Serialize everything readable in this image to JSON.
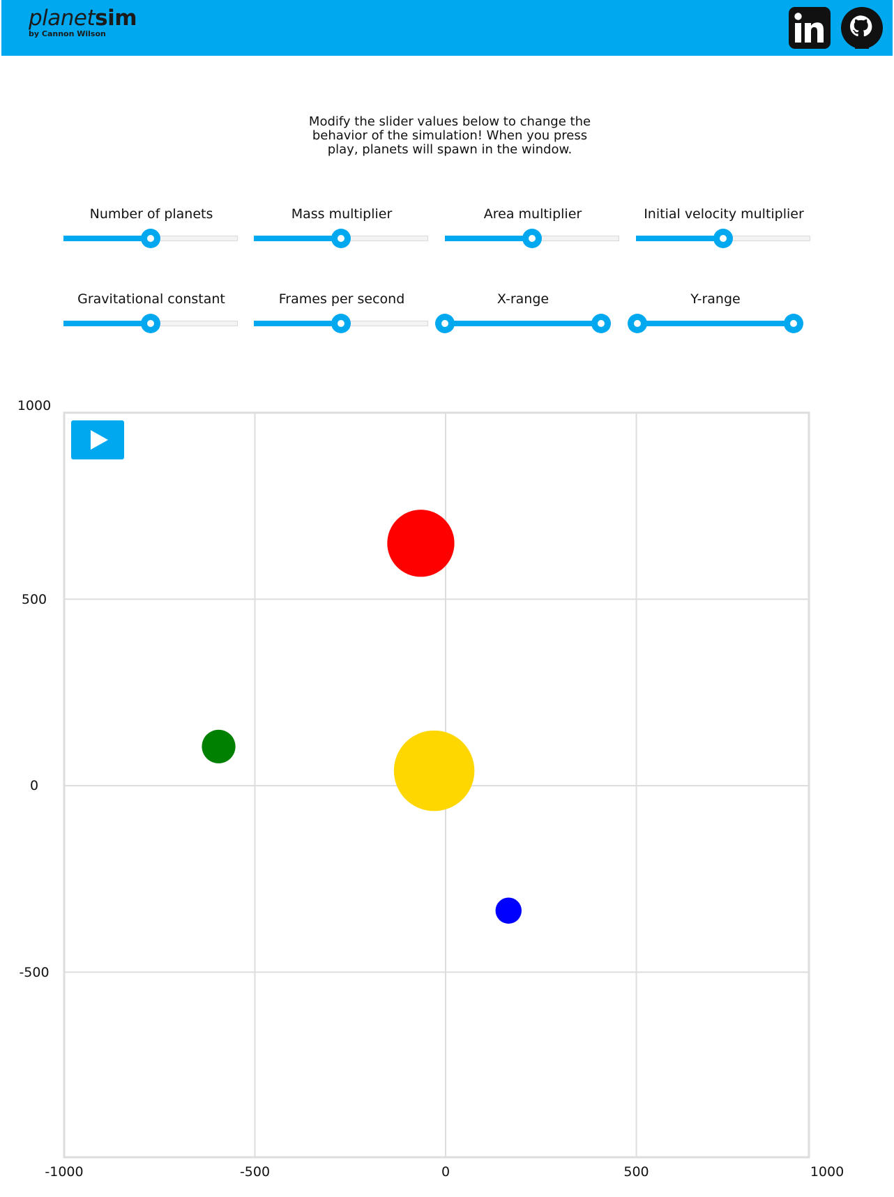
{
  "header": {
    "brand_light": "planet",
    "brand_bold": "sim",
    "byline": "by Cannon Wilson",
    "links": [
      {
        "icon": "linkedin-icon"
      },
      {
        "icon": "github-icon"
      }
    ],
    "color": "#00a8f0"
  },
  "description": "Modify the slider values below to change the behavior of the simulation! When you press play, planets will spawn in the window.",
  "sliders": [
    {
      "label": "Number of planets",
      "value": 0.5
    },
    {
      "label": "Mass multiplier",
      "value": 0.5
    },
    {
      "label": "Area multiplier",
      "value": 0.5
    },
    {
      "label": "Initial velocity multiplier",
      "value": 0.5
    },
    {
      "label": "Gravitational constant",
      "value": 0.5
    },
    {
      "label": "Frames per second",
      "value": 0.5
    },
    {
      "label": "X-range",
      "range": [
        0,
        1
      ]
    },
    {
      "label": "Y-range",
      "range": [
        0,
        1
      ]
    }
  ],
  "play": {
    "icon": "play-icon"
  },
  "chart_data": {
    "type": "scatter",
    "xlim": [
      -1000,
      1000
    ],
    "ylim": [
      -1000,
      1000
    ],
    "x_ticks": [
      "-1000",
      "-500",
      "0",
      "500",
      "1000"
    ],
    "y_ticks": [
      "1000",
      "500",
      "0",
      "-500"
    ],
    "grid": true,
    "points": [
      {
        "x": -65,
        "y": 650,
        "r": 90,
        "color": "#ff0000"
      },
      {
        "x": -595,
        "y": 105,
        "r": 45,
        "color": "#008000"
      },
      {
        "x": -30,
        "y": 40,
        "r": 108,
        "color": "#ffd700"
      },
      {
        "x": 165,
        "y": -335,
        "r": 35,
        "color": "#0000ff"
      }
    ]
  }
}
